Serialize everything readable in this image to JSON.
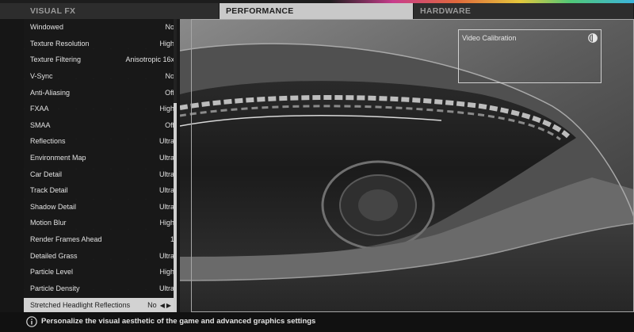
{
  "tabs": {
    "visual_fx": "VISUAL FX",
    "performance": "PERFORMANCE",
    "hardware": "HARDWARE"
  },
  "settings": [
    {
      "label": "Windowed",
      "value": "No"
    },
    {
      "label": "Texture Resolution",
      "value": "High"
    },
    {
      "label": "Texture Filtering",
      "value": "Anisotropic 16x"
    },
    {
      "label": "V-Sync",
      "value": "No"
    },
    {
      "label": "Anti-Aliasing",
      "value": "Off"
    },
    {
      "label": "FXAA",
      "value": "High"
    },
    {
      "label": "SMAA",
      "value": "Off"
    },
    {
      "label": "Reflections",
      "value": "Ultra"
    },
    {
      "label": "Environment Map",
      "value": "Ultra"
    },
    {
      "label": "Car Detail",
      "value": "Ultra"
    },
    {
      "label": "Track Detail",
      "value": "Ultra"
    },
    {
      "label": "Shadow Detail",
      "value": "Ultra"
    },
    {
      "label": "Motion Blur",
      "value": "High"
    },
    {
      "label": "Render Frames Ahead",
      "value": "1"
    },
    {
      "label": "Detailed Grass",
      "value": "Ultra"
    },
    {
      "label": "Particle Level",
      "value": "High"
    },
    {
      "label": "Particle Density",
      "value": "Ultra"
    },
    {
      "label": "Stretched Headlight Reflections",
      "value": "No"
    }
  ],
  "preview": {
    "calibration_label": "Video Calibration"
  },
  "footer": {
    "info_text": "Personalize the visual aesthetic of the game and advanced graphics settings"
  },
  "colors": {
    "selected_tab": "#c9c9c9",
    "selected_row": "#d2d2d2",
    "background": "#161616"
  },
  "icons": {
    "calibration": "contrast-circle-icon",
    "info": "info-circle-icon",
    "left": "triangle-left-icon",
    "right": "triangle-right-icon"
  }
}
